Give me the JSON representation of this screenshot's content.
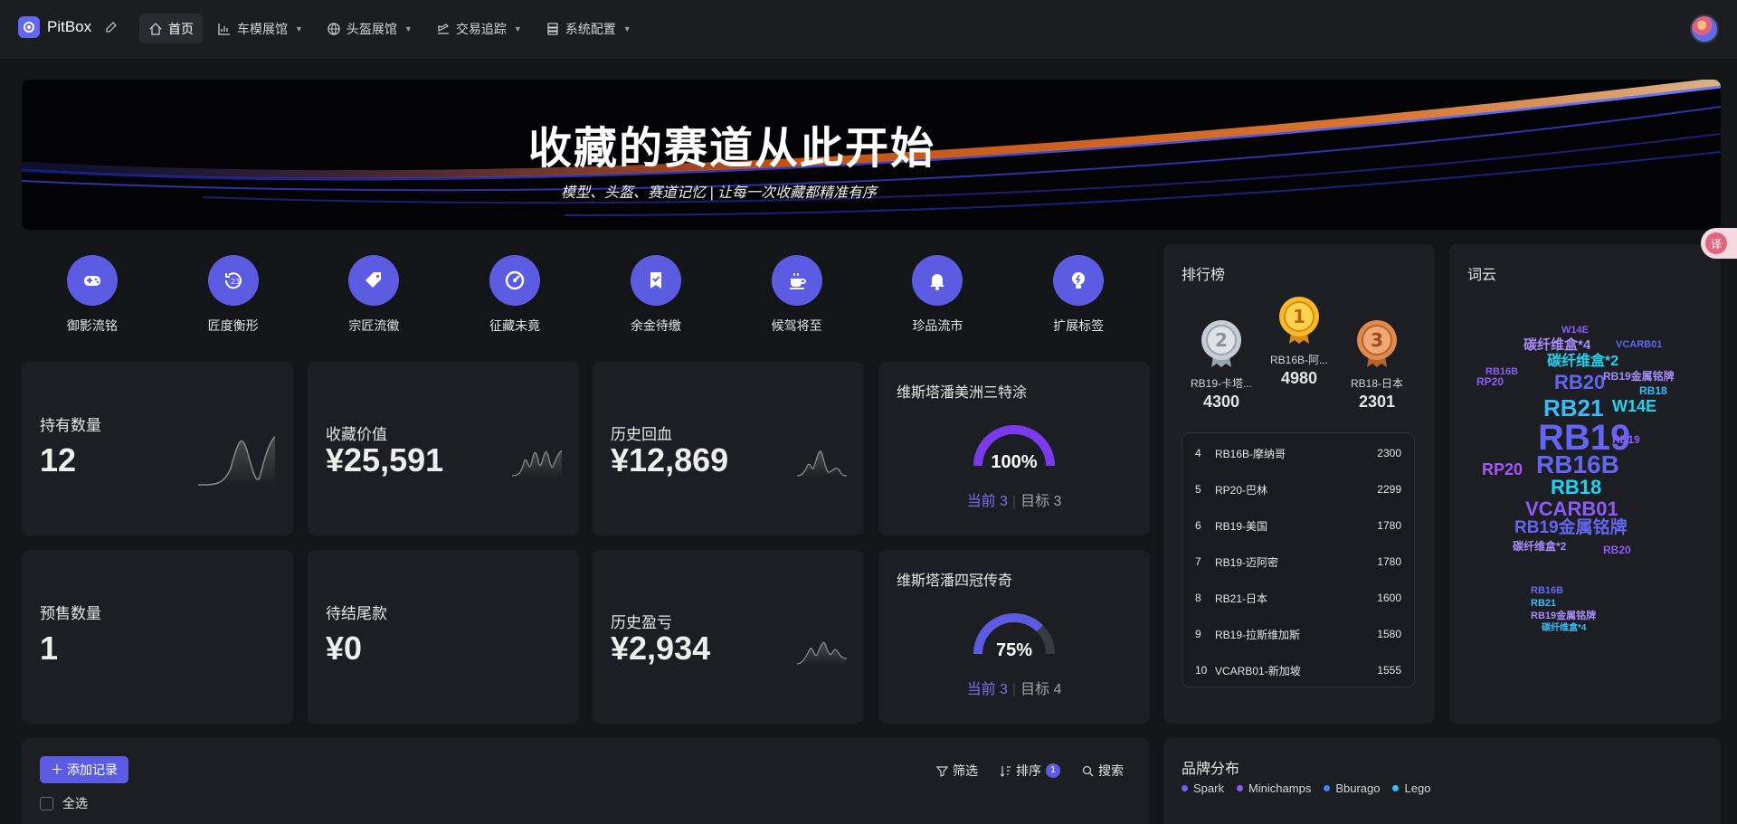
{
  "app": {
    "name": "PitBox"
  },
  "nav": [
    {
      "label": "首页",
      "icon": "home-icon",
      "active": true
    },
    {
      "label": "车模展馆",
      "icon": "car-chart-icon"
    },
    {
      "label": "头盔展馆",
      "icon": "globe-icon"
    },
    {
      "label": "交易追踪",
      "icon": "plane-icon"
    },
    {
      "label": "系统配置",
      "icon": "server-icon"
    }
  ],
  "banner": {
    "title": "收藏的赛道从此开始",
    "subtitle": "模型、头盔、赛道记忆 | 让每一次收藏都精准有序"
  },
  "quick_actions": [
    {
      "label": "御影流铭",
      "icon": "gamepad-icon"
    },
    {
      "label": "匠度衡形",
      "icon": "counter-icon"
    },
    {
      "label": "宗匠流徽",
      "icon": "tag-icon"
    },
    {
      "label": "征藏未竟",
      "icon": "gauge-icon"
    },
    {
      "label": "余金待缴",
      "icon": "bookmark-check-icon"
    },
    {
      "label": "候驾将至",
      "icon": "coffee-icon"
    },
    {
      "label": "珍品流市",
      "icon": "bell-icon"
    },
    {
      "label": "扩展标签",
      "icon": "bulb-icon"
    }
  ],
  "stats": {
    "holdings": {
      "label": "持有数量",
      "value": "12"
    },
    "value": {
      "label": "收藏价值",
      "value": "¥25,591"
    },
    "recovered": {
      "label": "历史回血",
      "value": "¥12,869"
    },
    "presale": {
      "label": "预售数量",
      "value": "1"
    },
    "balance": {
      "label": "待结尾款",
      "value": "¥0"
    },
    "pnl": {
      "label": "历史盈亏",
      "value": "¥2,934"
    }
  },
  "goals": [
    {
      "title": "维斯塔潘美洲三特涂",
      "percent": "100%",
      "ratio": 1.0,
      "current_label": "当前 3",
      "target_label": "目标 3"
    },
    {
      "title": "维斯塔潘四冠传奇",
      "percent": "75%",
      "ratio": 0.75,
      "current_label": "当前 3",
      "target_label": "目标 4"
    }
  ],
  "leaderboard": {
    "title": "排行榜",
    "podium": [
      {
        "rank": "2",
        "name": "RB19-卡塔...",
        "score": "4300"
      },
      {
        "rank": "1",
        "name": "RB16B-阿...",
        "score": "4980"
      },
      {
        "rank": "3",
        "name": "RB18-日本",
        "score": "2301"
      }
    ],
    "rows": [
      {
        "rank": "4",
        "name": "RB16B-摩纳哥",
        "score": "2300"
      },
      {
        "rank": "5",
        "name": "RP20-巴林",
        "score": "2299"
      },
      {
        "rank": "6",
        "name": "RB19-美国",
        "score": "1780"
      },
      {
        "rank": "7",
        "name": "RB19-迈阿密",
        "score": "1780"
      },
      {
        "rank": "8",
        "name": "RB21-日本",
        "score": "1600"
      },
      {
        "rank": "9",
        "name": "RB19-拉斯维加斯",
        "score": "1580"
      },
      {
        "rank": "10",
        "name": "VCARB01-新加坡",
        "score": "1555"
      }
    ]
  },
  "wordcloud": {
    "title": "词云",
    "words": [
      {
        "text": "W14E",
        "color": "#8b5cf6"
      },
      {
        "text": "碳纤维盒*4",
        "color": "#a78bfa"
      },
      {
        "text": "VCARB01",
        "color": "#6366f1"
      },
      {
        "text": "碳纤维盒*2",
        "color": "#22d3ee"
      },
      {
        "text": "RB16B",
        "color": "#8b5cf6"
      },
      {
        "text": "RB20",
        "color": "#6366f1"
      },
      {
        "text": "RB18",
        "color": "#38bdf8"
      },
      {
        "text": "RB19金属铭牌",
        "color": "#a78bfa"
      },
      {
        "text": "RP20",
        "color": "#8b5cf6"
      },
      {
        "text": "RB21",
        "color": "#38bdf8"
      },
      {
        "text": "W14E",
        "color": "#22d3ee"
      },
      {
        "text": "RB19",
        "color": "#6366f1"
      },
      {
        "text": "RB16B",
        "color": "#6366f1"
      },
      {
        "text": "RP20",
        "color": "#a855f7"
      },
      {
        "text": "RB18",
        "color": "#22d3ee"
      },
      {
        "text": "VCARB01",
        "color": "#8b5cf6"
      },
      {
        "text": "RB19金属铭牌",
        "color": "#6366f1"
      },
      {
        "text": "碳纤维盒*2",
        "color": "#a78bfa"
      },
      {
        "text": "RB20",
        "color": "#8b5cf6"
      },
      {
        "text": "RB19",
        "color": "#8b5cf6"
      },
      {
        "text": "RB16B",
        "color": "#6366f1"
      },
      {
        "text": "RB21",
        "color": "#38bdf8"
      },
      {
        "text": "RB19金属铭牌",
        "color": "#a78bfa"
      },
      {
        "text": "碳纤维盒*4",
        "color": "#38bdf8"
      }
    ]
  },
  "records": {
    "add_label": "添加记录",
    "filter_label": "筛选",
    "sort_label": "排序",
    "sort_count": "1",
    "search_label": "搜索",
    "select_all_label": "全选"
  },
  "brands": {
    "title": "品牌分布",
    "items": [
      {
        "name": "Spark",
        "color": "#6366f1"
      },
      {
        "name": "Minichamps",
        "color": "#8b5cf6"
      },
      {
        "name": "Bburago",
        "color": "#3b82f6"
      },
      {
        "name": "Lego",
        "color": "#38bdf8"
      }
    ]
  },
  "floating": {
    "label": "译"
  }
}
